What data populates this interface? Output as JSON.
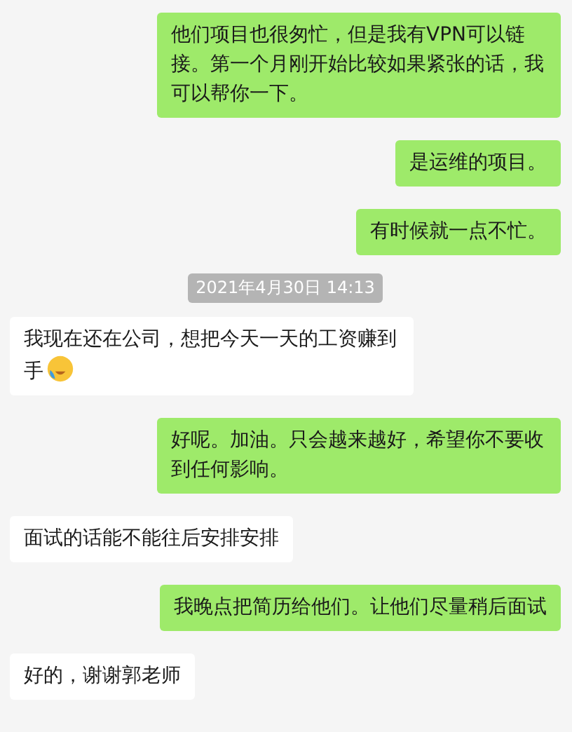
{
  "messages": [
    {
      "kind": "sent",
      "text": "他们项目也很匆忙，但是我有VPN可以链接。第一个月刚开始比较如果紧张的话，我可以帮你一下。",
      "emoji": false
    },
    {
      "kind": "sent",
      "text": "是运维的项目。",
      "emoji": false
    },
    {
      "kind": "sent",
      "text": "有时候就一点不忙。",
      "emoji": false
    },
    {
      "kind": "time",
      "text": "2021年4月30日 14:13"
    },
    {
      "kind": "received",
      "text": "我现在还在公司，想把今天一天的工资赚到手",
      "emoji": true
    },
    {
      "kind": "sent",
      "text": "好呢。加油。只会越来越好，希望你不要收到任何影响。",
      "emoji": false
    },
    {
      "kind": "received",
      "text": "面试的话能不能往后安排安排",
      "emoji": false
    },
    {
      "kind": "sent",
      "text": "我晚点把简历给他们。让他们尽量稍后面试",
      "emoji": false
    },
    {
      "kind": "received",
      "text": "好的，谢谢郭老师",
      "emoji": false
    }
  ]
}
